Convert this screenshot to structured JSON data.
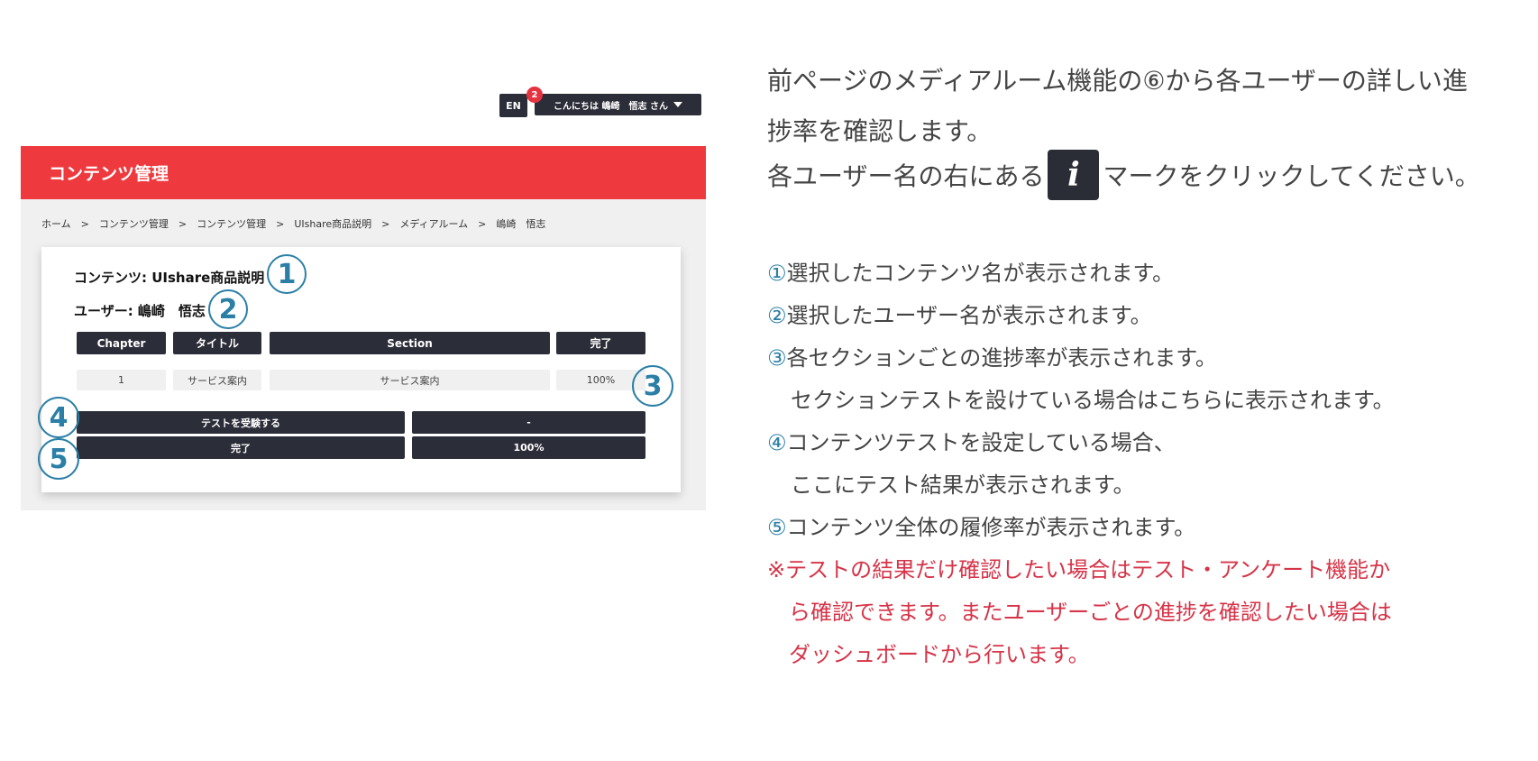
{
  "topbar": {
    "lang_button": "EN",
    "notification_count": "2",
    "user_greeting": "こんにちは 嶋崎　悟志 さん"
  },
  "header": {
    "title": "コンテンツ管理"
  },
  "breadcrumb": [
    "ホーム",
    "コンテンツ管理",
    "コンテンツ管理",
    "UIshare商品説明",
    "メディアルーム",
    "嶋崎　悟志"
  ],
  "breadcrumb_separator": ">",
  "card": {
    "content_line": "コンテンツ: UIshare商品説明",
    "user_line": "ユーザー: 嶋崎　悟志",
    "table": {
      "headers": [
        "Chapter",
        "タイトル",
        "Section",
        "完了"
      ],
      "rows": [
        [
          "1",
          "サービス案内",
          "サービス案内",
          "100%"
        ]
      ]
    },
    "test_row": {
      "label": "テストを受験する",
      "value": "-"
    },
    "complete_row": {
      "label": "完了",
      "value": "100%"
    }
  },
  "markers": [
    "1",
    "2",
    "3",
    "4",
    "5"
  ],
  "explanation": {
    "line1": "前ページのメディアルーム機能の⑥から各ユーザーの詳しい進",
    "line2": "捗率を確認します。",
    "line3_before": "各ユーザー名の右にある",
    "info_icon": "i",
    "line3_after": "マークをクリックしてください。",
    "items": [
      {
        "marker": "①",
        "text": "選択したコンテンツ名が表示されます。"
      },
      {
        "marker": "②",
        "text": "選択したユーザー名が表示されます。"
      },
      {
        "marker": "③",
        "text": "各セクションごとの進捗率が表示されます。"
      },
      {
        "marker": "",
        "text": "セクションテストを設けている場合はこちらに表示されます。"
      },
      {
        "marker": "④",
        "text": "コンテンツテストを設定している場合、"
      },
      {
        "marker": "",
        "text": "ここにテスト結果が表示されます。"
      },
      {
        "marker": "⑤",
        "text": "コンテンツ全体の履修率が表示されます。"
      }
    ],
    "note": [
      "※テストの結果だけ確認したい場合はテスト・アンケート機能か",
      "ら確認できます。またユーザーごとの進捗を確認したい場合は",
      "ダッシュボードから行います。"
    ]
  },
  "colors": {
    "accent_red": "#ee3a3f",
    "dark": "#2b2d38",
    "marker_blue": "#2b7fa6",
    "note_red": "#d63448"
  }
}
